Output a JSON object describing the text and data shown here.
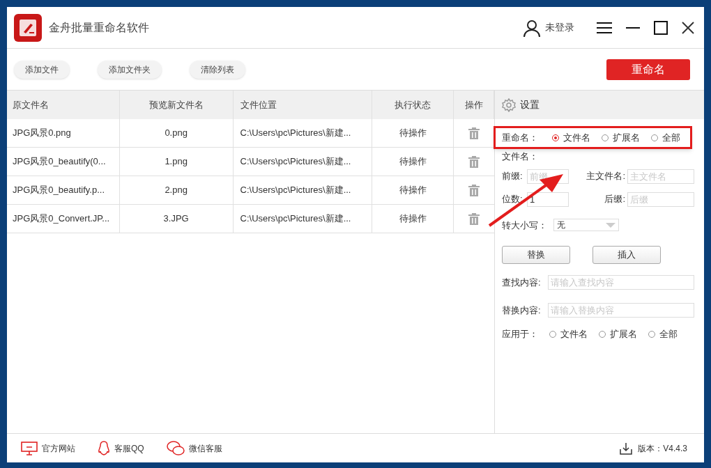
{
  "window": {
    "title": "金舟批量重命名软件",
    "user": "未登录"
  },
  "toolbar": {
    "buttons": [
      "添加文件",
      "添加文件夹",
      "清除列表"
    ],
    "primary": "重命名"
  },
  "table": {
    "columns": [
      "原文件名",
      "预览新文件名",
      "文件位置",
      "执行状态",
      "操作"
    ],
    "rows": [
      {
        "original": "JPG风景0.png",
        "preview": "0.png",
        "location": "C:\\Users\\pc\\Pictures\\新建...",
        "status": "待操作"
      },
      {
        "original": "JPG风景0_beautify(0...",
        "preview": "1.png",
        "location": "C:\\Users\\pc\\Pictures\\新建...",
        "status": "待操作"
      },
      {
        "original": "JPG风景0_beautify.p...",
        "preview": "2.png",
        "location": "C:\\Users\\pc\\Pictures\\新建...",
        "status": "待操作"
      },
      {
        "original": "JPG风景0_Convert.JP...",
        "preview": "3.JPG",
        "location": "C:\\Users\\pc\\Pictures\\新建...",
        "status": "待操作"
      }
    ]
  },
  "settings": {
    "title": "设置",
    "rename_label": "重命名：",
    "rename_options": [
      {
        "label": "文件名",
        "selected": true
      },
      {
        "label": "扩展名",
        "selected": false
      },
      {
        "label": "全部",
        "selected": false
      }
    ],
    "filename_label": "文件名：",
    "prefix": {
      "label": "前缀:",
      "placeholder": "前缀"
    },
    "main_name": {
      "label": "主文件名:",
      "placeholder": "主文件名"
    },
    "digits": {
      "label": "位数:",
      "value": "1"
    },
    "suffix": {
      "label": "后缀:",
      "placeholder": "后缀"
    },
    "case": {
      "label": "转大小写：",
      "value": "无"
    },
    "buttons": [
      "替换",
      "插入"
    ],
    "find": {
      "label": "查找内容:",
      "placeholder": "请输入查找内容"
    },
    "replace": {
      "label": "替换内容:",
      "placeholder": "请输入替换内容"
    },
    "apply_label": "应用于：",
    "apply_options": [
      {
        "label": "文件名",
        "selected": false
      },
      {
        "label": "扩展名",
        "selected": false
      },
      {
        "label": "全部",
        "selected": false
      }
    ]
  },
  "footer": {
    "links": [
      {
        "kind": "monitor",
        "label": "官方网站"
      },
      {
        "kind": "qq",
        "label": "客服QQ"
      },
      {
        "kind": "wechat",
        "label": "微信客服"
      }
    ],
    "version": "版本：V4.4.3"
  }
}
